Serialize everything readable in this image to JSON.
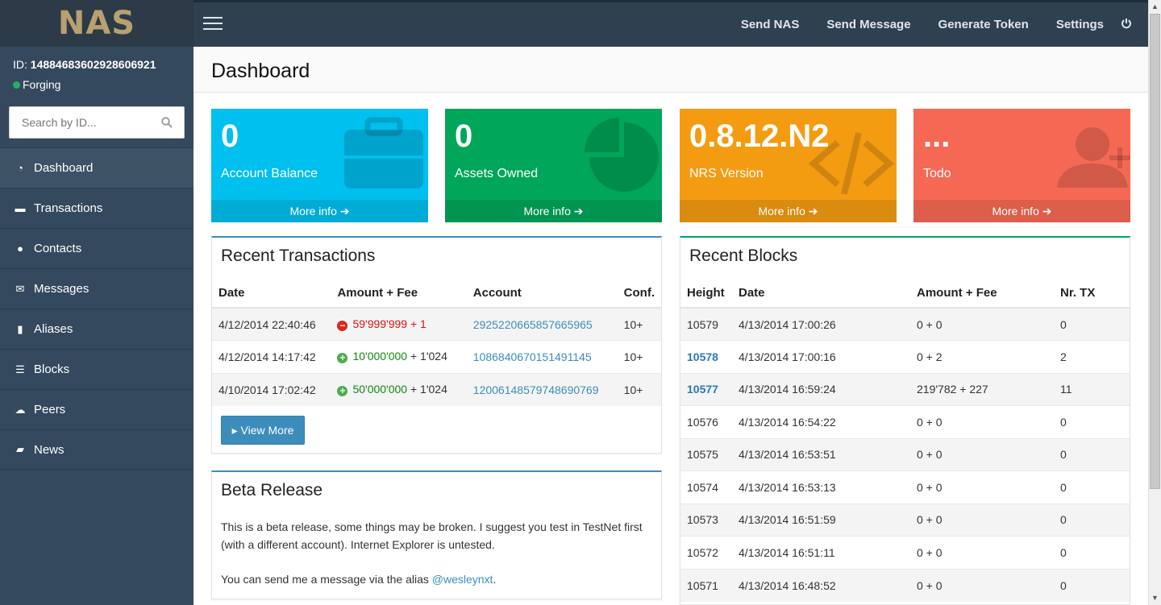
{
  "app": {
    "logo": "NAS"
  },
  "nav": {
    "links": [
      "Send NAS",
      "Send Message",
      "Generate Token",
      "Settings"
    ],
    "power_icon": "power-icon"
  },
  "user": {
    "id_label": "ID:",
    "id_value": "14884683602928606921",
    "status": "Forging",
    "status_color": "#27ae60"
  },
  "search": {
    "placeholder": "Search by ID..."
  },
  "sidebar": {
    "items": [
      {
        "label": "Dashboard",
        "icon": "dashboard-icon",
        "glyph": "◔"
      },
      {
        "label": "Transactions",
        "icon": "briefcase-icon",
        "glyph": "▬"
      },
      {
        "label": "Contacts",
        "icon": "user-icon",
        "glyph": "●"
      },
      {
        "label": "Messages",
        "icon": "envelope-icon",
        "glyph": "✉"
      },
      {
        "label": "Aliases",
        "icon": "bookmark-icon",
        "glyph": "▮"
      },
      {
        "label": "Blocks",
        "icon": "list-icon",
        "glyph": "☰"
      },
      {
        "label": "Peers",
        "icon": "cloud-icon",
        "glyph": "☁"
      },
      {
        "label": "News",
        "icon": "book-icon",
        "glyph": "▰"
      }
    ]
  },
  "page": {
    "title": "Dashboard"
  },
  "tiles": [
    {
      "value": "0",
      "label": "Account Balance",
      "more": "More info",
      "color": "#00c0ef",
      "icon": "briefcase-icon"
    },
    {
      "value": "0",
      "label": "Assets Owned",
      "more": "More info",
      "color": "#00a65a",
      "icon": "pie-chart-icon"
    },
    {
      "value": "0.8.12.N2",
      "label": "NRS Version",
      "more": "More info",
      "color": "#f39c12",
      "icon": "code-icon"
    },
    {
      "value": "...",
      "label": "Todo",
      "more": "More info",
      "color": "#f56954",
      "icon": "add-user-icon"
    }
  ],
  "recent_transactions": {
    "title": "Recent Transactions",
    "columns": [
      "Date",
      "Amount + Fee",
      "Account",
      "Conf."
    ],
    "rows": [
      {
        "date": "4/12/2014 22:40:46",
        "sign": "minus",
        "amount": "59'999'999",
        "fee": "+ 1",
        "account": "2925220665857665965",
        "conf": "10+"
      },
      {
        "date": "4/12/2014 14:17:42",
        "sign": "plus",
        "amount": "10'000'000",
        "fee": "+ 1'024",
        "account": "1086840670151491145",
        "conf": "10+"
      },
      {
        "date": "4/10/2014 17:02:42",
        "sign": "plus",
        "amount": "50'000'000",
        "fee": "+ 1'024",
        "account": "12006148579748690769",
        "conf": "10+"
      }
    ],
    "button": "View More"
  },
  "beta": {
    "title": "Beta Release",
    "p1": "This is a beta release, some things may be broken. I suggest you test in TestNet first (with a different account). Internet Explorer is untested.",
    "p2_prefix": "You can send me a message via the alias ",
    "p2_link": "@wesleynxt",
    "p2_suffix": "."
  },
  "recent_blocks": {
    "title": "Recent Blocks",
    "columns": [
      "Height",
      "Date",
      "Amount + Fee",
      "Nr. TX"
    ],
    "rows": [
      {
        "height": "10579",
        "link": false,
        "date": "4/13/2014 17:00:26",
        "amount": "0 + 0",
        "tx": "0"
      },
      {
        "height": "10578",
        "link": true,
        "date": "4/13/2014 17:00:16",
        "amount": "0 + 2",
        "tx": "2"
      },
      {
        "height": "10577",
        "link": true,
        "date": "4/13/2014 16:59:24",
        "amount": "219'782 + 227",
        "tx": "11"
      },
      {
        "height": "10576",
        "link": false,
        "date": "4/13/2014 16:54:22",
        "amount": "0 + 0",
        "tx": "0"
      },
      {
        "height": "10575",
        "link": false,
        "date": "4/13/2014 16:53:51",
        "amount": "0 + 0",
        "tx": "0"
      },
      {
        "height": "10574",
        "link": false,
        "date": "4/13/2014 16:53:13",
        "amount": "0 + 0",
        "tx": "0"
      },
      {
        "height": "10573",
        "link": false,
        "date": "4/13/2014 16:51:59",
        "amount": "0 + 0",
        "tx": "0"
      },
      {
        "height": "10572",
        "link": false,
        "date": "4/13/2014 16:51:11",
        "amount": "0 + 0",
        "tx": "0"
      },
      {
        "height": "10571",
        "link": false,
        "date": "4/13/2014 16:48:52",
        "amount": "0 + 0",
        "tx": "0"
      }
    ]
  }
}
